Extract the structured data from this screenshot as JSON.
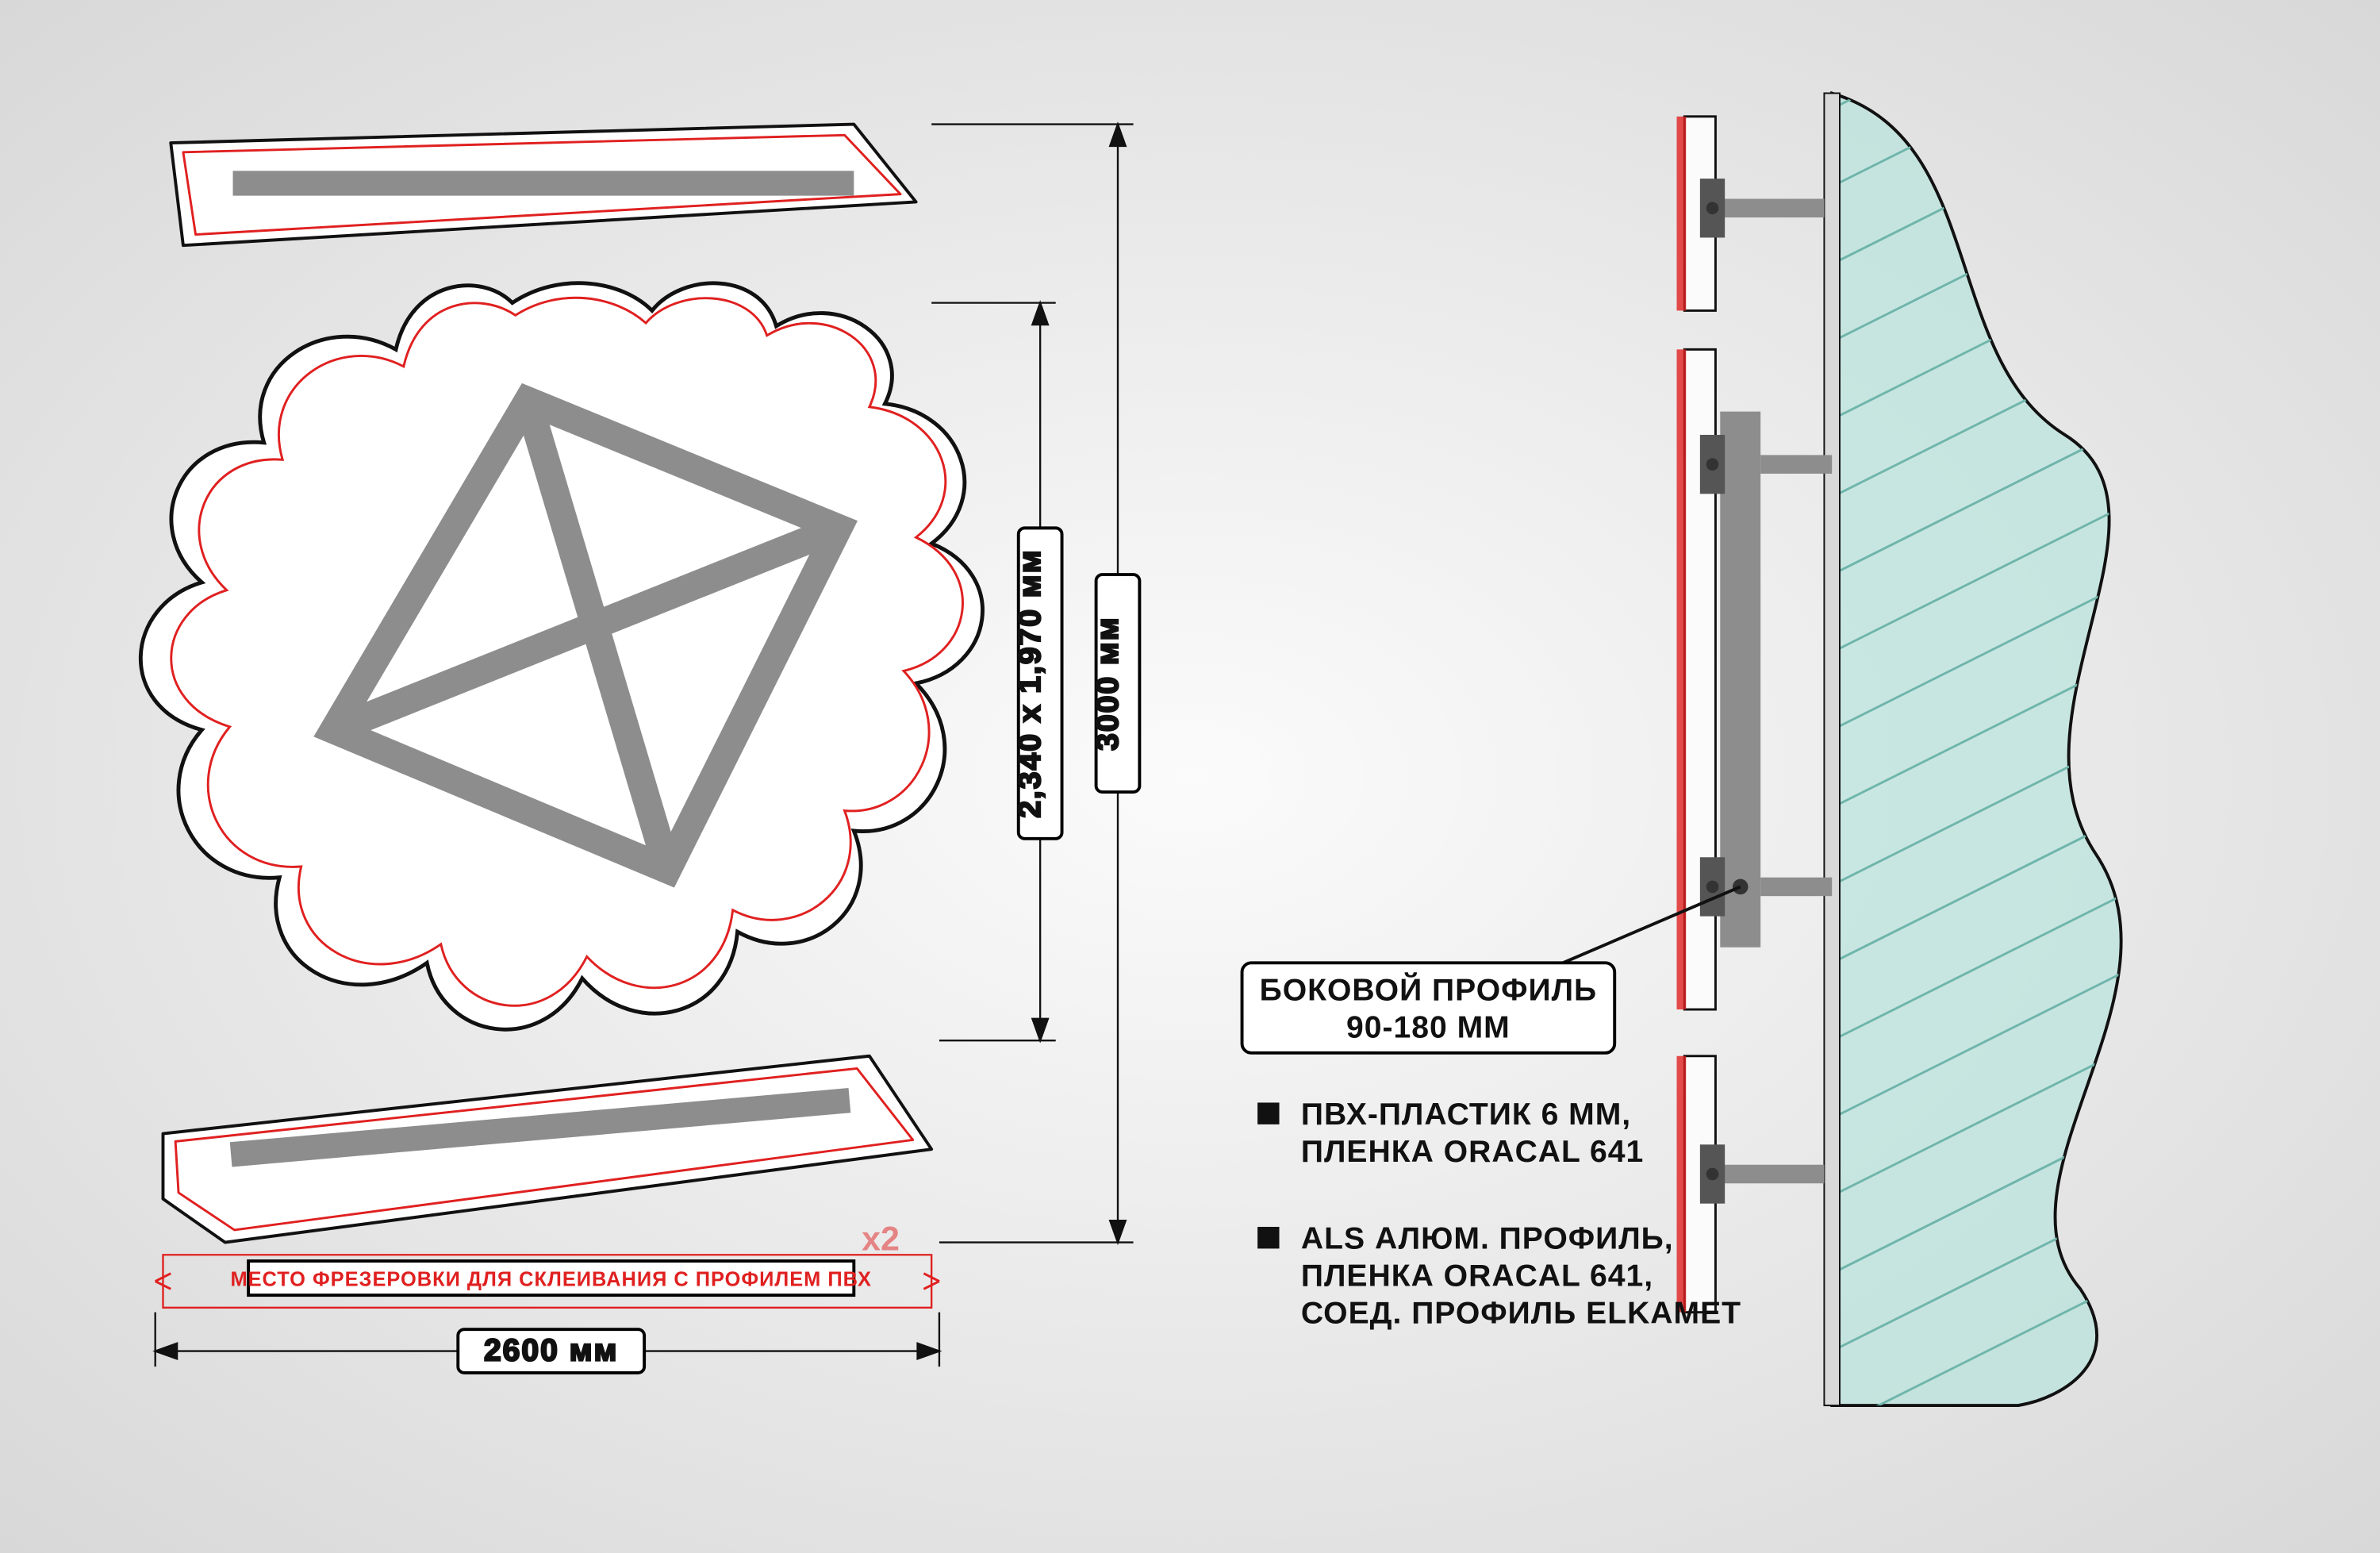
{
  "dimensions": {
    "height_total": "3000 мм",
    "height_mid": "2,340 x 1,970 мм",
    "width": "2600 мм"
  },
  "annotations": {
    "frez": "МЕСТО ФРЕЗЕРОВКИ ДЛЯ СКЛЕИВАНИЯ С ПРОФИЛЕМ ПВХ",
    "x2": "x2",
    "callout_line1": "БОКОВОЙ ПРОФИЛЬ",
    "callout_line2": "90-180 ММ"
  },
  "legend": {
    "item1_line1": "ПВХ-ПЛАСТИК 6 ММ,",
    "item1_line2": "ПЛЕНКА ORACAL 641",
    "item2_line1": "ALS АЛЮМ. ПРОФИЛЬ,",
    "item2_line2": "ПЛЕНКА ORACAL 641,",
    "item2_line3": "СОЕД. ПРОФИЛЬ ELKAMET"
  }
}
